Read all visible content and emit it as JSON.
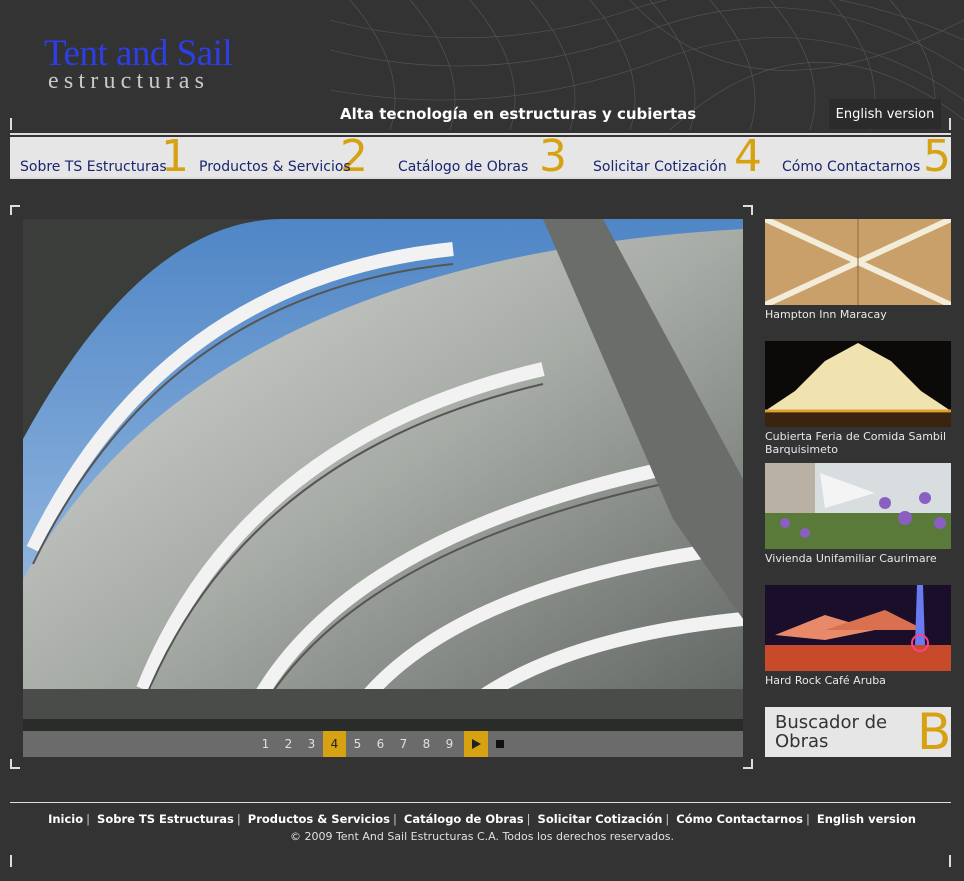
{
  "header": {
    "logo_title": "Tent and Sail",
    "logo_subtitle": "estructuras",
    "tagline": "Alta tecnología en estructuras y cubiertas",
    "english_label": "English version"
  },
  "nav": {
    "items": [
      {
        "label": "Sobre TS Estructuras",
        "num": "1"
      },
      {
        "label": "Productos & Servicios",
        "num": "2"
      },
      {
        "label": "Catálogo de Obras",
        "num": "3"
      },
      {
        "label": "Solicitar Cotización",
        "num": "4"
      },
      {
        "label": "Cómo Contactarnos",
        "num": "5"
      }
    ]
  },
  "slideshow": {
    "pages": [
      "1",
      "2",
      "3",
      "4",
      "5",
      "6",
      "7",
      "8",
      "9"
    ],
    "active_page": "4"
  },
  "thumbnails": [
    {
      "caption": "Hampton Inn Maracay"
    },
    {
      "caption": "Cubierta Feria de Comida Sambil Barquisimeto"
    },
    {
      "caption": "Vivienda Unifamiliar Caurimare"
    },
    {
      "caption": "Hard Rock Café Aruba"
    }
  ],
  "buscador": {
    "label": "Buscador de Obras",
    "letter": "B"
  },
  "footer": {
    "links": [
      "Inicio",
      "Sobre TS Estructuras",
      "Productos & Servicios",
      "Catálogo de Obras",
      "Solicitar Cotización",
      "Cómo Contactarnos",
      "English version"
    ],
    "copyright": "© 2009 Tent And Sail Estructuras C.A. Todos los derechos reservados."
  },
  "colors": {
    "background": "#333333",
    "accent": "#d6a212",
    "logo_blue": "#2d3ee6",
    "nav_bg": "#e6e6e6"
  }
}
